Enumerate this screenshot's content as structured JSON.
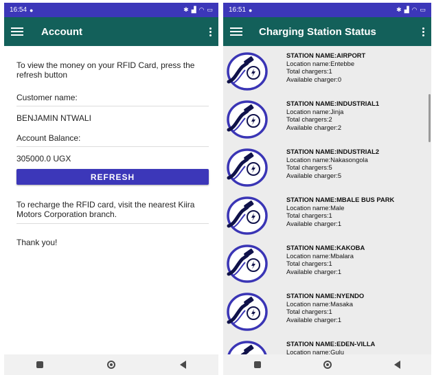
{
  "account_screen": {
    "status": {
      "time": "16:54"
    },
    "appbar": {
      "title": "Account"
    },
    "intro_text": "To view the money on your RFID Card, press the refresh button",
    "customer_label": "Customer name:",
    "customer_name": "BENJAMIN NTWALI",
    "balance_label": "Account Balance:",
    "balance_value": "305000.0 UGX",
    "refresh_label": "REFRESH",
    "recharge_text": "To recharge the RFID card, visit the nearest Kiira Motors Corporation branch.",
    "thanks_text": "Thank you!"
  },
  "stations_screen": {
    "status": {
      "time": "16:51"
    },
    "appbar": {
      "title": "Charging Station Status"
    },
    "stations": [
      {
        "name": "STATION NAME:AIRPORT",
        "location": "Location name:Entebbe",
        "total": "Total chargers:1",
        "available": "Available charger:0"
      },
      {
        "name": "STATION NAME:INDUSTRIAL1",
        "location": "Location name:Jinja",
        "total": "Total chargers:2",
        "available": "Available charger:2"
      },
      {
        "name": "STATION NAME:INDUSTRIAL2",
        "location": "Location name:Nakasongola",
        "total": "Total chargers:5",
        "available": "Available charger:5"
      },
      {
        "name": "STATION NAME:MBALE BUS PARK",
        "location": "Location name:Male",
        "total": "Total chargers:1",
        "available": "Available charger:1"
      },
      {
        "name": "STATION NAME:KAKOBA",
        "location": "Location name:Mbalara",
        "total": "Total chargers:1",
        "available": "Available charger:1"
      },
      {
        "name": "STATION NAME:NYENDO",
        "location": "Location name:Masaka",
        "total": "Total chargers:1",
        "available": "Available charger:1"
      },
      {
        "name": "STATION NAME:EDEN-VILLA",
        "location": "Location name:Gulu",
        "total": "",
        "available": ""
      }
    ]
  },
  "colors": {
    "statusbar": "#3c37b9",
    "appbar": "#13605a",
    "button": "#3c37b9",
    "list_bg": "#ececec",
    "logo_ring": "#3a35b5"
  },
  "icons": [
    "menu-icon",
    "more-vert-icon",
    "ev-charger-icon",
    "nav-recents-icon",
    "nav-home-icon",
    "nav-back-icon",
    "bluetooth-icon",
    "signal-icon",
    "wifi-icon",
    "battery-icon"
  ]
}
